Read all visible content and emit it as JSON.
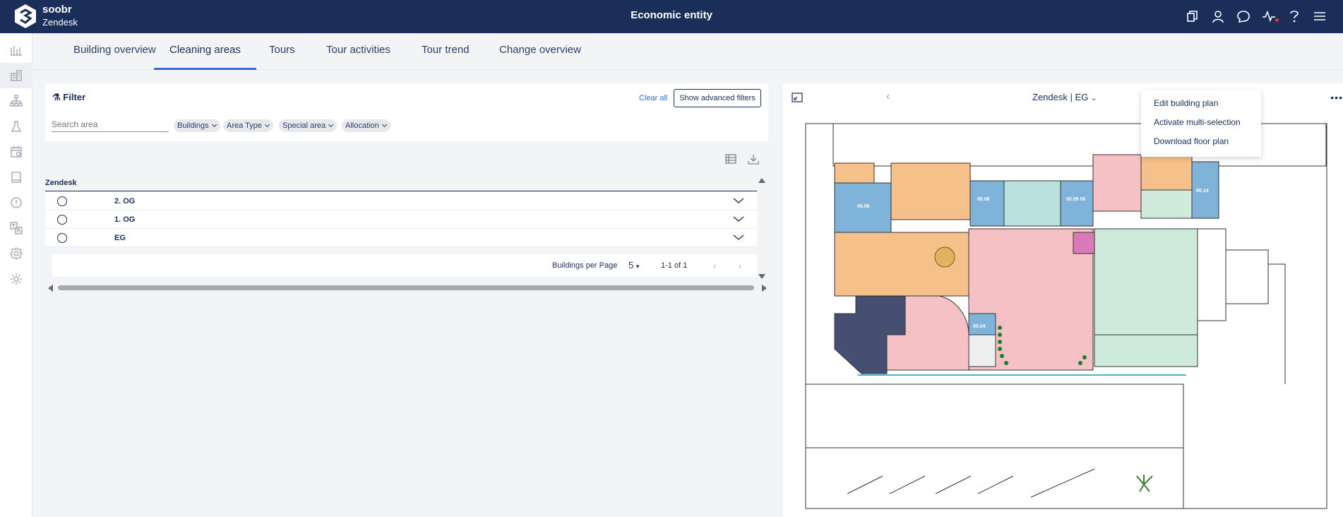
{
  "header": {
    "brand_name": "soobr",
    "account": "Zendesk",
    "title": "Economic entity",
    "icons": [
      "copy-icon",
      "user-icon",
      "chat-icon",
      "activity-icon",
      "help-icon",
      "menu-icon"
    ]
  },
  "rail": {
    "icons": [
      "bar-chart-icon",
      "building-icon",
      "hierarchy-icon",
      "flask-icon",
      "calendar-icon",
      "book-icon",
      "info-icon",
      "translate-icon",
      "badge-icon",
      "gear-icon"
    ],
    "active_index": 1
  },
  "tabs": [
    {
      "label": "Building overview",
      "active": false
    },
    {
      "label": "Cleaning areas",
      "active": true
    },
    {
      "label": "Tours",
      "active": false
    },
    {
      "label": "Tour activities",
      "active": false
    },
    {
      "label": "Tour trend",
      "active": false
    },
    {
      "label": "Change overview",
      "active": false
    }
  ],
  "filter": {
    "title": "Filter",
    "clear_all": "Clear all",
    "advanced": "Show advanced filters",
    "search_placeholder": "Search area",
    "chips": [
      "Buildings",
      "Area Type",
      "Special area",
      "Allocation"
    ]
  },
  "table": {
    "group": "Zendesk",
    "rows": [
      "2. OG",
      "1. OG",
      "EG"
    ],
    "per_page_label": "Buildings per Page",
    "per_page_value": "5",
    "range": "1-1 of 1"
  },
  "map": {
    "floor": "Zendesk | EG",
    "menu": [
      "Edit building plan",
      "Activate multi-selection",
      "Download floor plan"
    ],
    "room_labels": [
      "00.06",
      "00.08",
      "00.09 00",
      "00.14",
      "00.04"
    ],
    "colors": {
      "orange": "#f5c08a",
      "blue": "#7fb3d9",
      "teal": "#b9e0dc",
      "pink": "#f6c1c4",
      "mint": "#cdeadb",
      "navy": "#464e72",
      "magenta": "#d97bb8"
    }
  }
}
